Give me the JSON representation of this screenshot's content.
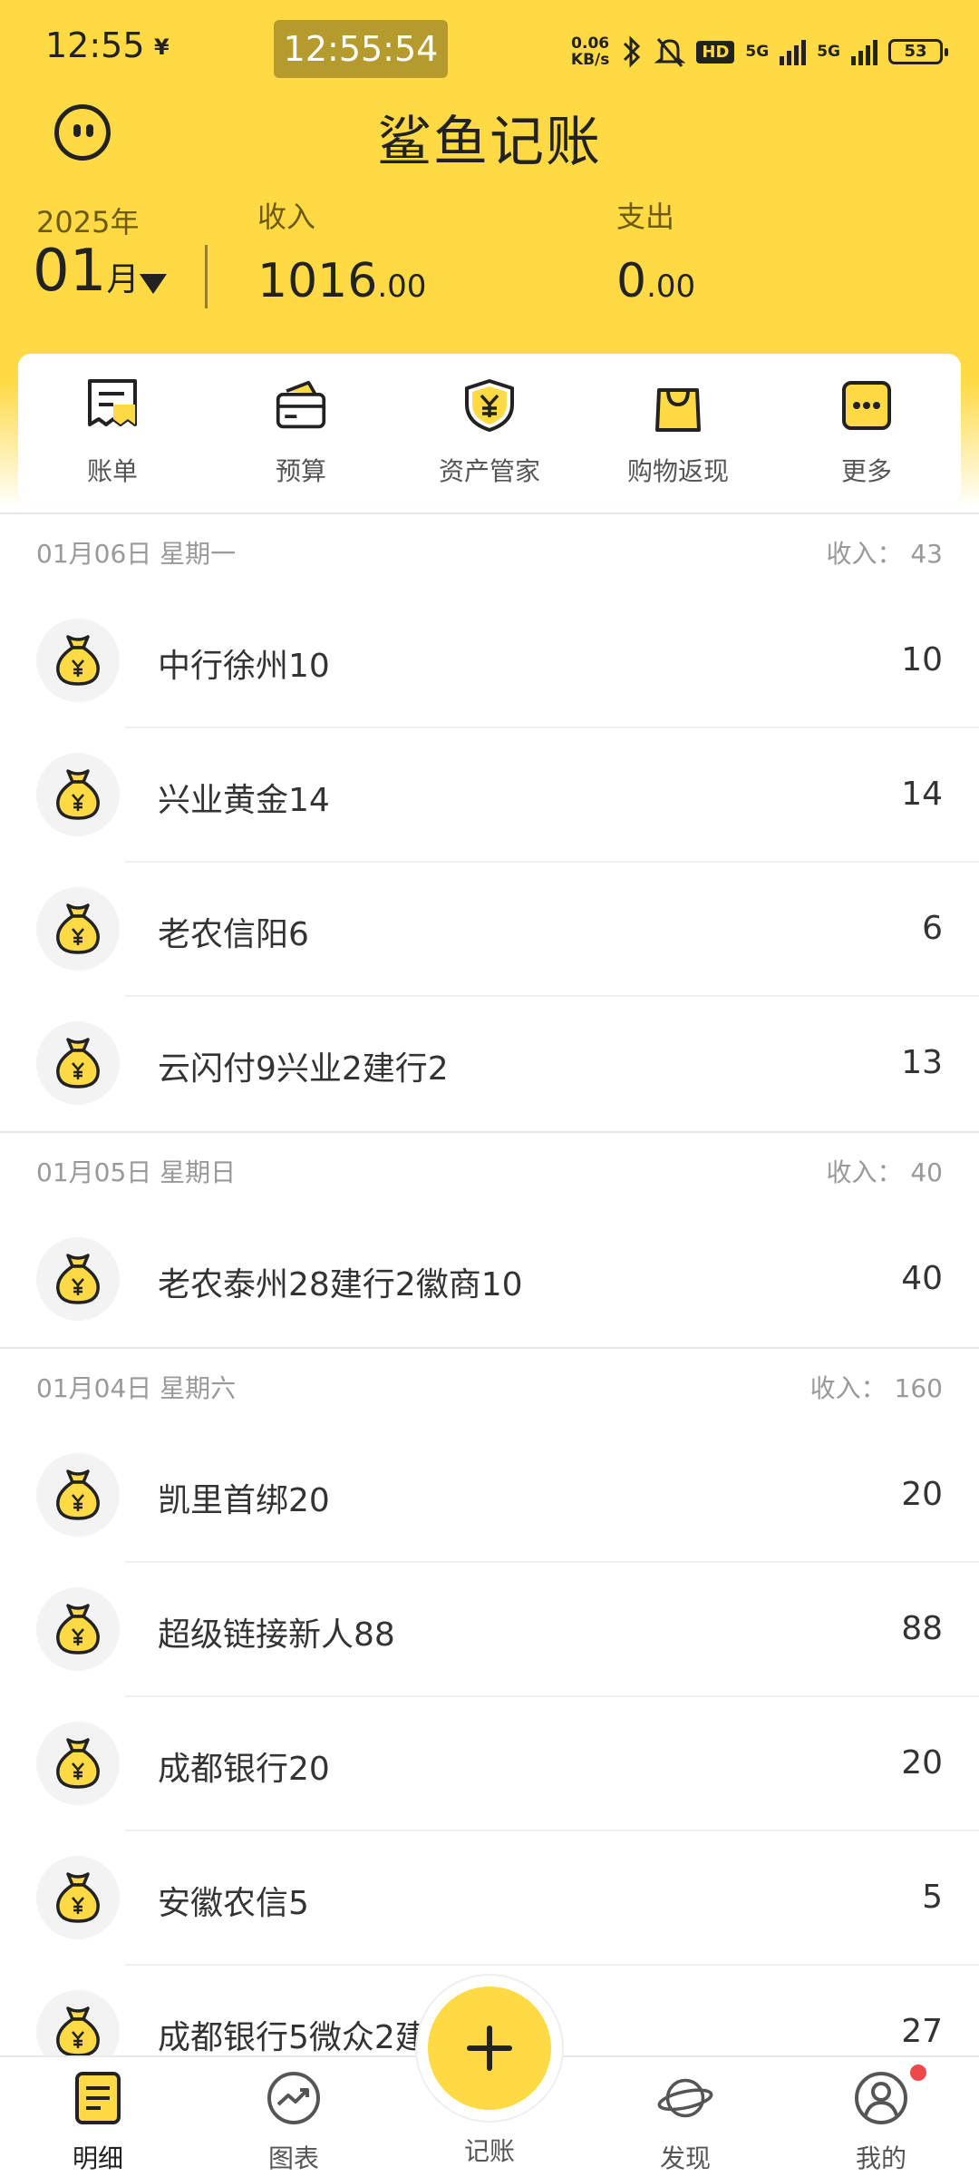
{
  "status_bar": {
    "time": "12:55",
    "yen": "¥",
    "clock_overlay": "12:55:54",
    "speed_value": "0.06",
    "speed_unit": "KB/s",
    "hd_label": "HD",
    "net1": "5G",
    "net2": "5G",
    "battery": "53"
  },
  "header": {
    "title": "鲨鱼记账",
    "year": "2025年",
    "month_number": "01",
    "month_suffix": "月",
    "income_label": "收入",
    "income_int": "1016",
    "income_dec": ".00",
    "expense_label": "支出",
    "expense_int": "0",
    "expense_dec": ".00"
  },
  "shortcuts": [
    {
      "label": "账单",
      "icon": "bill-icon"
    },
    {
      "label": "预算",
      "icon": "wallet-icon"
    },
    {
      "label": "资产管家",
      "icon": "shield-yen-icon"
    },
    {
      "label": "购物返现",
      "icon": "shopping-bag-icon"
    },
    {
      "label": "更多",
      "icon": "more-icon"
    }
  ],
  "groups": [
    {
      "date": "01月06日  星期一",
      "summary": "收入：  43",
      "rows": [
        {
          "title": "中行徐州10",
          "amount": "10"
        },
        {
          "title": "兴业黄金14",
          "amount": "14"
        },
        {
          "title": "老农信阳6",
          "amount": "6"
        },
        {
          "title": "云闪付9兴业2建行2",
          "amount": "13"
        }
      ]
    },
    {
      "date": "01月05日  星期日",
      "summary": "收入：  40",
      "rows": [
        {
          "title": "老农泰州28建行2徽商10",
          "amount": "40"
        }
      ]
    },
    {
      "date": "01月04日  星期六",
      "summary": "收入：  160",
      "rows": [
        {
          "title": "凯里首绑20",
          "amount": "20"
        },
        {
          "title": "超级链接新人88",
          "amount": "88"
        },
        {
          "title": "成都银行20",
          "amount": "20"
        },
        {
          "title": "安徽农信5",
          "amount": "5"
        },
        {
          "title": "成都银行5微众2建",
          "amount": "27"
        }
      ]
    }
  ],
  "tabbar": {
    "tab1": "明细",
    "tab2": "图表",
    "fab": "记账",
    "tab4": "发现",
    "tab5": "我的"
  },
  "colors": {
    "brand_yellow": "#FFDA44",
    "badge_red": "#F04848"
  }
}
